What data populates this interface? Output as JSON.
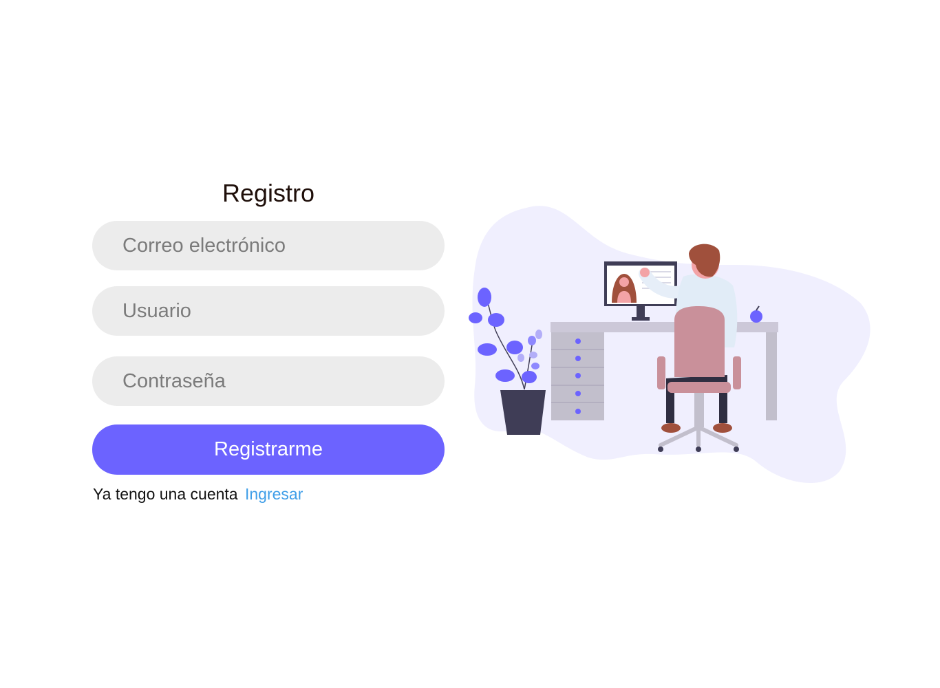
{
  "form": {
    "title": "Registro",
    "email_placeholder": "Correo electrónico",
    "username_placeholder": "Usuario",
    "password_placeholder": "Contraseña",
    "submit_label": "Registrarme",
    "footer_text": "Ya tengo una cuenta",
    "login_link": "Ingresar"
  },
  "colors": {
    "accent": "#6c63ff",
    "input_bg": "#ececec",
    "link": "#3f9ee8",
    "blob": "#f0effe"
  },
  "illustration": {
    "name": "person-working-at-desk-illustration"
  }
}
